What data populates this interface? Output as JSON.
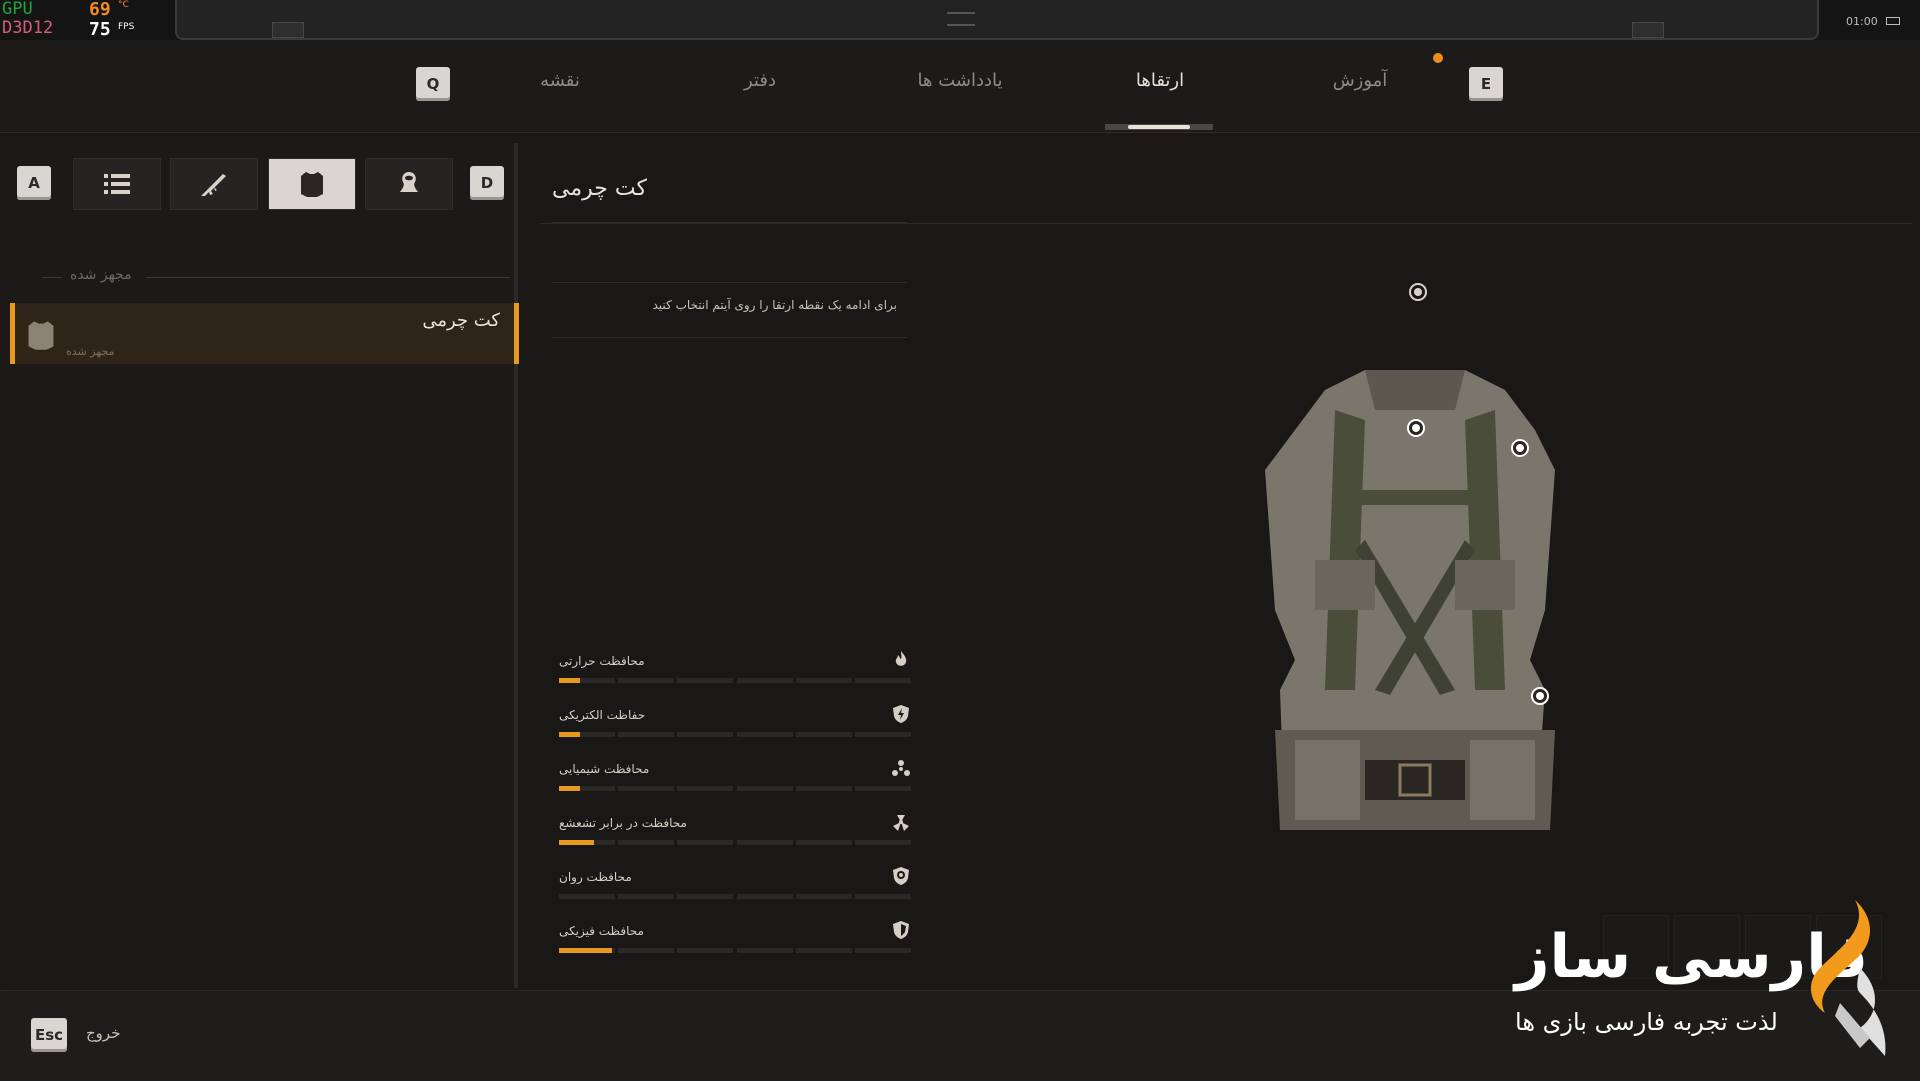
{
  "hud": {
    "gpu_label": "GPU",
    "api_label": "D3D12",
    "temp": "69",
    "temp_unit": "°C",
    "fps": "75",
    "fps_unit": "FPS",
    "clock": "01:00"
  },
  "nav": {
    "left_key": "Q",
    "right_key": "E",
    "tabs": [
      {
        "label": "نقشه"
      },
      {
        "label": "دفتر"
      },
      {
        "label": "یادداشت ها"
      },
      {
        "label": "ارتقاها"
      },
      {
        "label": "آموزش"
      }
    ],
    "active_tab": "ارتقاها"
  },
  "filters": {
    "left_key": "A",
    "right_key": "D",
    "buttons": [
      {
        "icon": "list-icon"
      },
      {
        "icon": "rifle-icon"
      },
      {
        "icon": "armor-icon",
        "active": true
      },
      {
        "icon": "artifact-icon"
      }
    ]
  },
  "inventory": {
    "section_title": "مجهز شده",
    "items": [
      {
        "name": "کت چرمی",
        "status": "مجهز شده",
        "icon": "jacket-icon"
      }
    ]
  },
  "detail": {
    "title": "کت چرمی",
    "hint": "برای ادامه یک نقطه ارتقا را روی آیتم انتخاب کنید",
    "stats": [
      {
        "label": "محافظت حرارتی",
        "icon": "flame-icon",
        "level": 0.06
      },
      {
        "label": "حفاظت الکتریکی",
        "icon": "electric-shield-icon",
        "level": 0.06
      },
      {
        "label": "محافظت شیمیایی",
        "icon": "chemical-icon",
        "level": 0.06
      },
      {
        "label": "محافظت در برابر تشعشع",
        "icon": "radiation-icon",
        "level": 0.1
      },
      {
        "label": "محافظت روان",
        "icon": "psy-shield-icon",
        "level": 0
      },
      {
        "label": "محافظت فیزیکی",
        "icon": "physical-shield-icon",
        "level": 0.15
      }
    ]
  },
  "footer": {
    "esc_key": "Esc",
    "exit_label": "خروج"
  },
  "watermark": {
    "brand": "فارسی ساز",
    "tagline": "لذت تجربه فارسی بازی ها"
  },
  "colors": {
    "accent": "#e89a20",
    "background": "#1a1817",
    "text": "#e9e4da"
  }
}
